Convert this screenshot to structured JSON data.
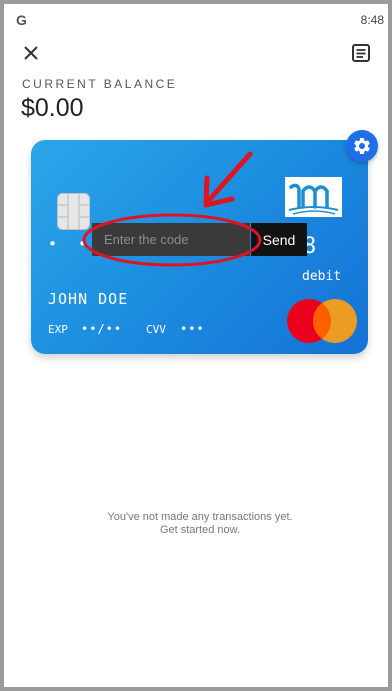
{
  "status_bar": {
    "left_icon_text": "G",
    "time": "8:48"
  },
  "header": {
    "close_icon": "close-icon",
    "menu_icon": "receipt-list-icon"
  },
  "balance": {
    "label": "CURRENT BALANCE",
    "value": "$0.00"
  },
  "card": {
    "number_masked": "• • •",
    "number_last": "8",
    "type": "debit",
    "holder": "JOHN DOE",
    "exp_label": "EXP",
    "exp_value": "••/••",
    "cvv_label": "CVV",
    "cvv_value": "•••",
    "settings_icon": "gear-icon",
    "network_logo": "mastercard-logo"
  },
  "code_entry": {
    "placeholder": "Enter the code",
    "value": "",
    "send_label": "Send"
  },
  "empty_state": {
    "line1": "You've not made any transactions yet.",
    "line2": "Get started now."
  },
  "colors": {
    "card_gradient_start": "#2ba6ea",
    "card_gradient_end": "#1472d6",
    "settings_button": "#1f6fe8",
    "annotation_red": "#e0141e",
    "mastercard_red": "#eb001b",
    "mastercard_orange": "#f79e1b"
  }
}
